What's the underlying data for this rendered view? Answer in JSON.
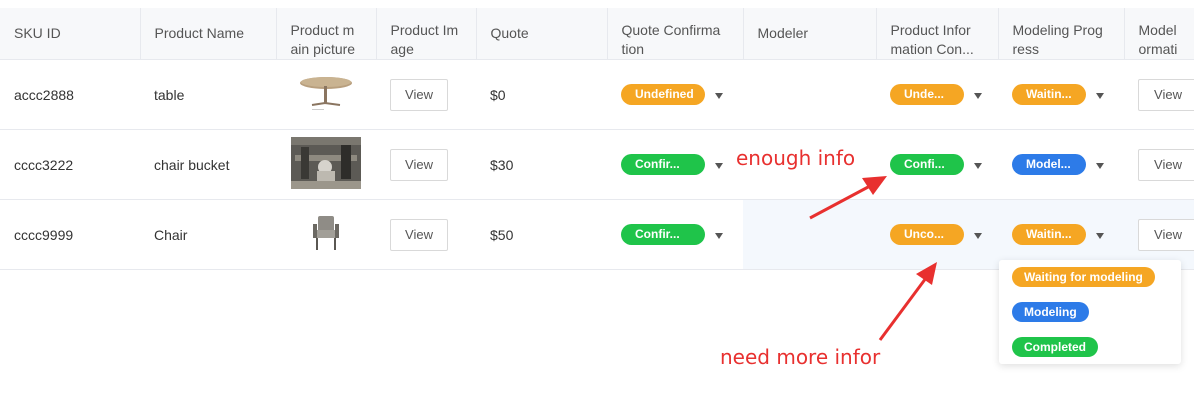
{
  "table": {
    "headers": {
      "sku": "SKU ID",
      "name": "Product Name",
      "main_pic_1": "Product m",
      "main_pic_2": "ain picture",
      "image_1": "Product Im",
      "image_2": "age",
      "quote": "Quote",
      "qconf_1": "Quote Confirma",
      "qconf_2": "tion",
      "modeler": "Modeler",
      "pinfo_1": "Product Infor",
      "pinfo_2": "mation Con...",
      "mprog_1": "Modeling Prog",
      "mprog_2": "ress",
      "minfo_1": "Model",
      "minfo_2": "ormati"
    },
    "rows": [
      {
        "sku": "accc2888",
        "name": "table",
        "image_button": "View",
        "quote": "$0",
        "quote_confirmation": "Undefined",
        "modeler": "",
        "product_info": "Unde...",
        "modeling_progress": "Waitin...",
        "model_info_button": "View"
      },
      {
        "sku": "cccc3222",
        "name": "chair bucket",
        "image_button": "View",
        "quote": "$30",
        "quote_confirmation": "Confir...",
        "modeler": "",
        "product_info": "Confi...",
        "modeling_progress": "Model...",
        "model_info_button": "View"
      },
      {
        "sku": "cccc9999",
        "name": "Chair",
        "image_button": "View",
        "quote": "$50",
        "quote_confirmation": "Confir...",
        "modeler": "",
        "product_info": "Unco...",
        "modeling_progress": "Waitin...",
        "model_info_button": "View"
      }
    ]
  },
  "dropdown": {
    "options": [
      "Waiting for modeling",
      "Modeling",
      "Completed"
    ]
  },
  "annotations": {
    "enough": "enough info",
    "need_more": "need more infor"
  },
  "colors": {
    "orange": "#f5a623",
    "green": "#1fc44a",
    "blue": "#2d7be8",
    "annotation_red": "#e8302f"
  }
}
